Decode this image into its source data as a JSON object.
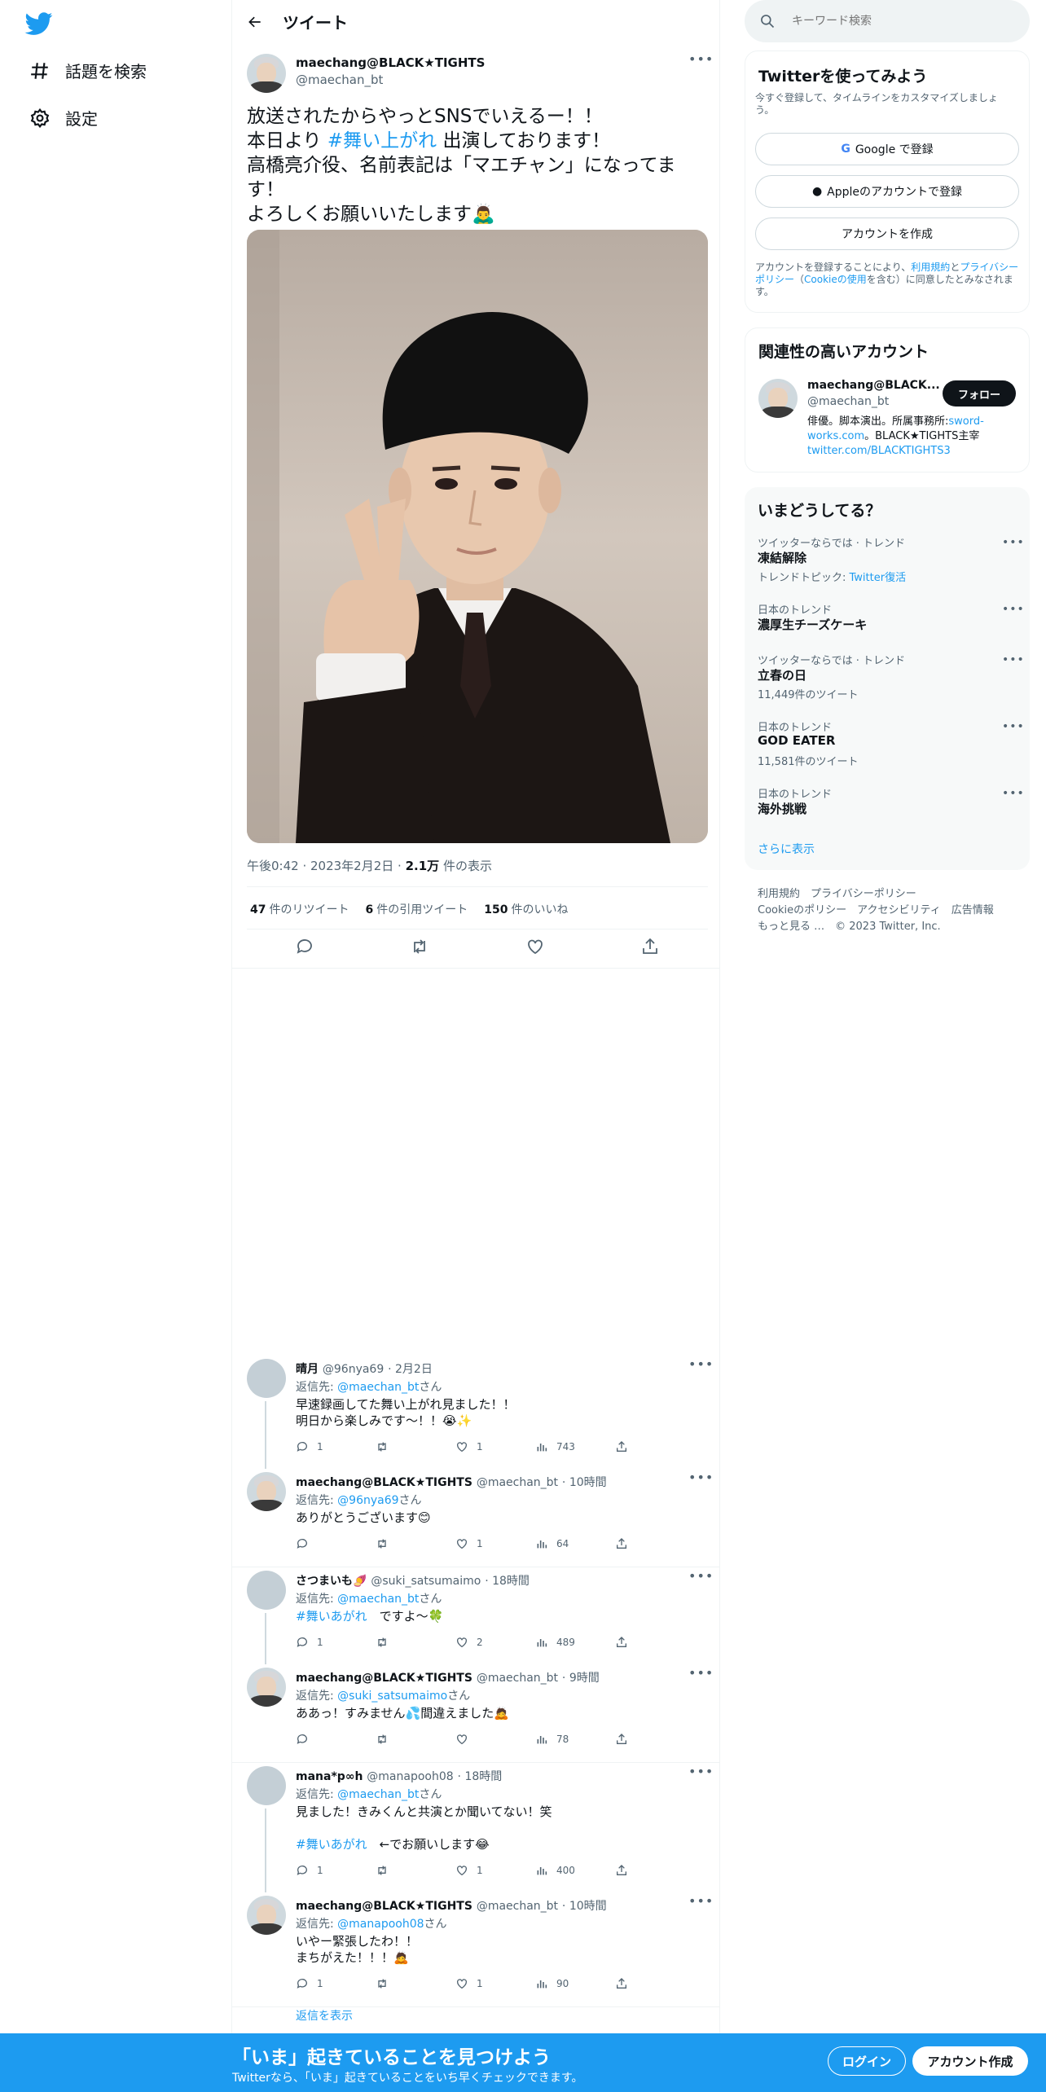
{
  "nav": {
    "items": [
      {
        "label": "話題を検索",
        "icon": "hashtag-icon"
      },
      {
        "label": "設定",
        "icon": "gear-icon"
      }
    ]
  },
  "header": {
    "title": "ツイート"
  },
  "tweet": {
    "author_name": "maechang@BLACK★TIGHTS",
    "author_handle": "@maechan_bt",
    "line1": "放送されたからやっとSNSでいえるー！！",
    "line2_pre": "本日より ",
    "line2_tag": "#舞い上がれ",
    "line2_post": " 出演しております！",
    "line3": "高橋亮介役、名前表記は「マエチャン」になってます！",
    "line4": "よろしくお願いいたします🙇‍♂️",
    "time": "午後0:42",
    "date": "2023年2月2日",
    "views_count": "2.1万",
    "views_label": "件の表示",
    "retweets_count": "47",
    "retweets_label": "件のリツイート",
    "quotes_count": "6",
    "quotes_label": "件の引用ツイート",
    "likes_count": "150",
    "likes_label": "件のいいね"
  },
  "replies": [
    {
      "name": "晴月",
      "handle": "@96nya69",
      "time": "· 2月2日",
      "to_prefix": "返信先: ",
      "to": "@maechan_bt",
      "to_suffix": "さん",
      "line1": "早速録画してた舞い上がれ見ました！！",
      "line2": "明日から楽しみです〜！！😭✨",
      "reply": "1",
      "retweet": "",
      "like": "1",
      "views": "743"
    },
    {
      "name": "maechang@BLACK★TIGHTS",
      "handle": "@maechan_bt",
      "time": "· 10時間",
      "to_prefix": "返信先: ",
      "to": "@96nya69",
      "to_suffix": "さん",
      "line1": "ありがとうございます😊",
      "line2": "",
      "reply": "",
      "retweet": "",
      "like": "1",
      "views": "64"
    },
    {
      "name": "さつまいも🍠",
      "handle": "@suki_satsumaimo",
      "time": "· 18時間",
      "to_prefix": "返信先: ",
      "to": "@maechan_bt",
      "to_suffix": "さん",
      "tag": "#舞いあがれ",
      "line1": "　ですよ〜🍀",
      "line2": "",
      "reply": "1",
      "retweet": "",
      "like": "2",
      "views": "489"
    },
    {
      "name": "maechang@BLACK★TIGHTS",
      "handle": "@maechan_bt",
      "time": "· 9時間",
      "to_prefix": "返信先: ",
      "to": "@suki_satsumaimo",
      "to_suffix": "さん",
      "line1": "ああっ！すみません💦間違えました🙇",
      "line2": "",
      "reply": "",
      "retweet": "",
      "like": "",
      "views": "78"
    },
    {
      "name": "mana*p∞h",
      "handle": "@manapooh08",
      "time": "· 18時間",
      "to_prefix": "返信先: ",
      "to": "@maechan_bt",
      "to_suffix": "さん",
      "line1": "見ました！きみくんと共演とか聞いてない！笑",
      "tag": "#舞いあがれ",
      "line2": "　←でお願いします😂",
      "reply": "1",
      "retweet": "",
      "like": "1",
      "views": "400"
    },
    {
      "name": "maechang@BLACK★TIGHTS",
      "handle": "@maechan_bt",
      "time": "· 10時間",
      "to_prefix": "返信先: ",
      "to": "@manapooh08",
      "to_suffix": "さん",
      "line1": "いやー緊張したわ！！",
      "line2": "まちがえた！！！🙇",
      "reply": "1",
      "retweet": "",
      "like": "1",
      "views": "90"
    }
  ],
  "show_replies": "返信を表示",
  "search": {
    "placeholder": "キーワード検索"
  },
  "signup": {
    "title": "Twitterを使ってみよう",
    "subtitle": "今すぐ登録して、タイムラインをカスタマイズしましょう。",
    "google_label": "Google で登録",
    "apple_label": "Appleのアカウントで登録",
    "create_label": "アカウントを作成",
    "legal_1": "アカウントを登録することにより、",
    "legal_terms": "利用規約",
    "legal_2": "と",
    "legal_privacy": "プライバシーポリシー",
    "legal_3": "（",
    "legal_cookie": "Cookieの使用",
    "legal_4": "を含む）に同意したとみなされます。"
  },
  "related": {
    "title": "関連性の高いアカウント",
    "name": "maechang@BLACK...",
    "handle": "@maechan_bt",
    "follow_label": "フォロー",
    "bio_1": "俳優。脚本演出。所属事務所:",
    "bio_link1": "sword-works.com",
    "bio_2": "。BLACK★TIGHTS主宰",
    "bio_link2": "twitter.com/BLACKTIGHTS3"
  },
  "trends": {
    "title": "いまどうしてる？",
    "items": [
      {
        "category": "ツイッターならでは · トレンド",
        "name": "凍結解除",
        "sub_prefix": "トレンドトピック: ",
        "sub_link": "Twitter復活"
      },
      {
        "category": "日本のトレンド",
        "name": "濃厚生チーズケーキ",
        "sub_prefix": "",
        "sub_link": ""
      },
      {
        "category": "ツイッターならでは · トレンド",
        "name": "立春の日",
        "sub_prefix": "11,449件のツイート",
        "sub_link": ""
      },
      {
        "category": "日本のトレンド",
        "name": "GOD EATER",
        "sub_prefix": "11,581件のツイート",
        "sub_link": ""
      },
      {
        "category": "日本のトレンド",
        "name": "海外挑戦",
        "sub_prefix": "",
        "sub_link": ""
      }
    ],
    "more": "さらに表示"
  },
  "footer": {
    "line1": "利用規約　プライバシーポリシー",
    "line2": "Cookieのポリシー　アクセシビリティ　広告情報",
    "line3": "もっと見る …　© 2023 Twitter, Inc."
  },
  "bottom": {
    "headline": "「いま」起きていることを見つけよう",
    "sub": "Twitterなら、「いま」起きていることをいち早くチェックできます。",
    "login": "ログイン",
    "signup": "アカウント作成"
  },
  "colors": {
    "accent": "#1d9bf0",
    "text": "#0f1419",
    "muted": "#536471"
  }
}
